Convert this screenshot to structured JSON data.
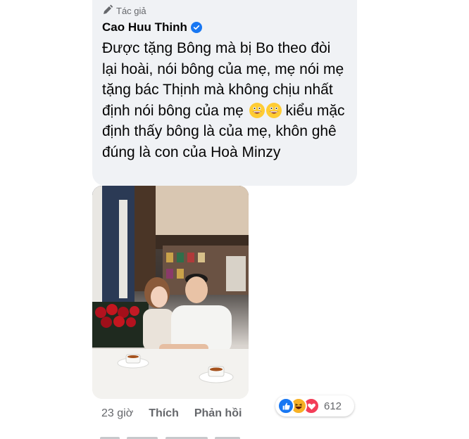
{
  "comment": {
    "badge_label": "Tác giả",
    "author_name": "Cao Huu Thinh",
    "text_main": "Được tặng Bông mà bị Bo theo đòi lại hoài, nói bông của mẹ, mẹ nói mẹ tặng bác Thịnh mà không chịu nhất định nói bông của mẹ ",
    "text_after_emoji": " kiểu mặc định thấy bông là của mẹ, khôn ghê đúng là con của Hoà Minzy",
    "emoji_name": "grinning-face-icon"
  },
  "actions": {
    "time": "23 giờ",
    "like_label": "Thích",
    "reply_label": "Phản hồi"
  },
  "reactions": {
    "icons": [
      "like-icon",
      "haha-icon",
      "love-icon"
    ],
    "count": "612"
  },
  "colors": {
    "bubble_bg": "#f0f2f5",
    "verified_blue": "#1877f2",
    "secondary_text": "#65676b"
  }
}
